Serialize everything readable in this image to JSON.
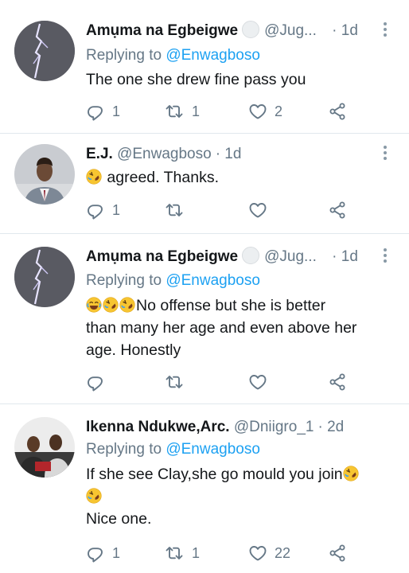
{
  "tweets": [
    {
      "name": "Amụma na Egbeigwe",
      "handle": "@Jug...",
      "time": "· 1d",
      "verified_badge": true,
      "replying_label": "Replying to",
      "replying_to": "@Enwagboso",
      "text": "The one she drew fine pass you",
      "emoji_prefix": [],
      "actions": {
        "reply": "1",
        "retweet": "1",
        "like": "2"
      }
    },
    {
      "name": "E.J.",
      "handle": "@Enwagboso",
      "time": "· 1d",
      "verified_badge": false,
      "replying_label": "",
      "replying_to": "",
      "text": "agreed.  Thanks.",
      "emoji_prefix": [
        "rofl"
      ],
      "actions": {
        "reply": "1",
        "retweet": "",
        "like": ""
      }
    },
    {
      "name": "Amụma na Egbeigwe",
      "handle": "@Jug...",
      "time": "· 1d",
      "verified_badge": true,
      "replying_label": "Replying to",
      "replying_to": "@Enwagboso",
      "text_lines": [
        "No offense but she is better",
        "than many her age and even above her",
        "age. Honestly"
      ],
      "emoji_prefix": [
        "joy",
        "rofl",
        "rofl"
      ],
      "actions": {
        "reply": "",
        "retweet": "",
        "like": ""
      }
    },
    {
      "name": "Ikenna Ndukwe,Arc.",
      "handle": "@Dniigro_1",
      "time": "· 2d",
      "verified_badge": false,
      "replying_label": "Replying to",
      "replying_to": "@Enwagboso",
      "text_lines": [
        "If she see Clay,she go mould you join",
        "",
        "Nice one."
      ],
      "emoji_markers": [
        "rofl",
        "rofl"
      ],
      "actions": {
        "reply": "1",
        "retweet": "1",
        "like": "22"
      }
    }
  ],
  "icons": [
    "reply-icon",
    "retweet-icon",
    "like-icon",
    "share-icon",
    "more-icon"
  ],
  "colors": {
    "text": "#14171a",
    "secondary": "#657786",
    "link": "#1da1f2",
    "divider": "#e1e8ed"
  }
}
